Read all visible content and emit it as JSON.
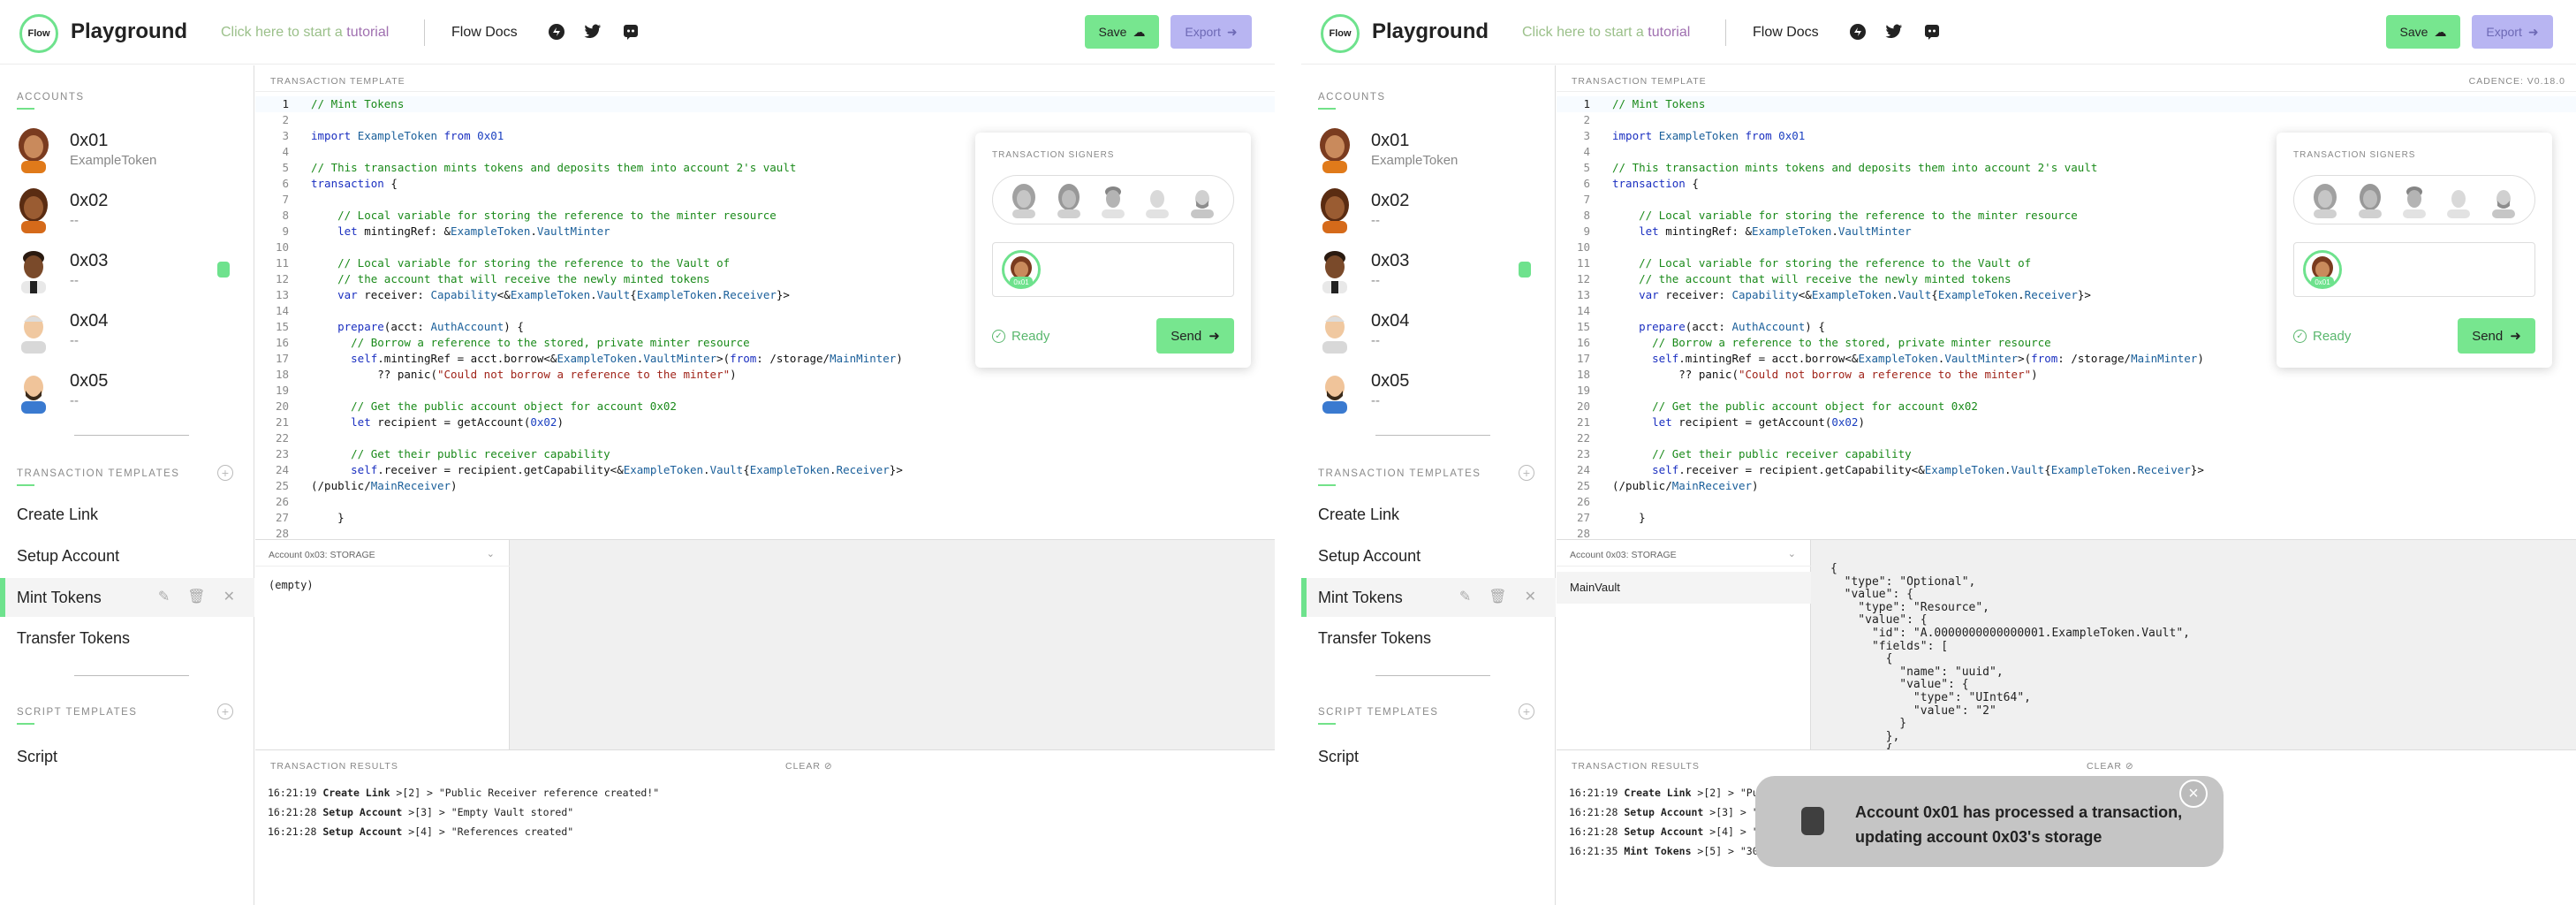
{
  "app": {
    "logo_text": "Flow",
    "title": "Playground",
    "tutorial_prefix": "Click here to start a ",
    "tutorial_link": "tutorial",
    "docs_label": "Flow Docs",
    "save_label": "Save",
    "export_label": "Export",
    "colors": {
      "accent": "#6ee28d",
      "export": "#b8b5f2",
      "tutorial": "#a070b0"
    }
  },
  "sidebar": {
    "accounts_heading": "ACCOUNTS",
    "accounts": [
      {
        "address": "0x01",
        "subtitle": "ExampleToken"
      },
      {
        "address": "0x02",
        "subtitle": "--"
      },
      {
        "address": "0x03",
        "subtitle": "--"
      },
      {
        "address": "0x04",
        "subtitle": "--"
      },
      {
        "address": "0x05",
        "subtitle": "--"
      }
    ],
    "tx_heading": "TRANSACTION TEMPLATES",
    "tx_templates": [
      "Create Link",
      "Setup Account",
      "Mint Tokens",
      "Transfer Tokens"
    ],
    "script_heading": "SCRIPT TEMPLATES",
    "script_templates": [
      "Script"
    ]
  },
  "editor": {
    "header": "TRANSACTION TEMPLATE",
    "cadence_version": "CADENCE: V0.18.0",
    "line_numbers": [
      "1",
      "2",
      "3",
      "4",
      "5",
      "6",
      "7",
      "8",
      "9",
      "10",
      "11",
      "12",
      "13",
      "14",
      "15",
      "16",
      "17",
      "18",
      "19",
      "20",
      "21",
      "22",
      "23",
      "24",
      "25",
      "26",
      "27",
      "28"
    ],
    "code": [
      "// Mint Tokens",
      "",
      "import ExampleToken from 0x01",
      "",
      "// This transaction mints tokens and deposits them into account 2's vault",
      "transaction {",
      "",
      "    // Local variable for storing the reference to the minter resource",
      "    let mintingRef: &ExampleToken.VaultMinter",
      "",
      "    // Local variable for storing the reference to the Vault of",
      "    // the account that will receive the newly minted tokens",
      "    var receiver: Capability<&ExampleToken.Vault{ExampleToken.Receiver}>",
      "",
      "    prepare(acct: AuthAccount) {",
      "      // Borrow a reference to the stored, private minter resource",
      "      self.mintingRef = acct.borrow<&ExampleToken.VaultMinter>(from: /storage/MainMinter)",
      "          ?? panic(\"Could not borrow a reference to the minter\")",
      "",
      "      // Get the public account object for account 0x02",
      "      let recipient = getAccount(0x02)",
      "",
      "      // Get their public receiver capability",
      "      self.receiver = recipient.getCapability<&ExampleToken.Vault{ExampleToken.Receiver}>",
      "(/public/MainReceiver)",
      "",
      "    }",
      ""
    ]
  },
  "signers": {
    "heading": "TRANSACTION SIGNERS",
    "chosen_label": "0x01",
    "status": "Ready",
    "send_label": "Send"
  },
  "left": {
    "storage_selector": "Account 0x03: STORAGE",
    "storage_empty": "(empty)",
    "results_heading": "TRANSACTION RESULTS",
    "clear_label": "CLEAR",
    "results": [
      {
        "time": "16:21:19",
        "name": "Create Link",
        "rest": " >[2] > \"Public Receiver reference created!\""
      },
      {
        "time": "16:21:28",
        "name": "Setup Account",
        "rest": " >[3] > \"Empty Vault stored\""
      },
      {
        "time": "16:21:28",
        "name": "Setup Account",
        "rest": " >[4] > \"References created\""
      }
    ]
  },
  "right": {
    "storage_selector": "Account 0x03: STORAGE",
    "storage_item": "MainVault",
    "storage_json": [
      "{",
      "  \"type\": \"Optional\",",
      "  \"value\": {",
      "    \"type\": \"Resource\",",
      "    \"value\": {",
      "      \"id\": \"A.0000000000000001.ExampleToken.Vault\",",
      "      \"fields\": [",
      "        {",
      "          \"name\": \"uuid\",",
      "          \"value\": {",
      "            \"type\": \"UInt64\",",
      "            \"value\": \"2\"",
      "          }",
      "        },",
      "        {"
    ],
    "results_heading": "TRANSACTION RESULTS",
    "clear_label": "CLEAR",
    "results": [
      {
        "time": "16:21:19",
        "name": "Create Link",
        "rest": " >[2] > \"Pub"
      },
      {
        "time": "16:21:28",
        "name": "Setup Account",
        "rest": " >[3] > \""
      },
      {
        "time": "16:21:28",
        "name": "Setup Account",
        "rest": " >[4] > \""
      },
      {
        "time": "16:21:35",
        "name": "Mint Tokens",
        "rest": " >[5] > \"30"
      }
    ],
    "toast_message": "Account 0x01 has processed a transaction, updating account 0x03's storage"
  }
}
